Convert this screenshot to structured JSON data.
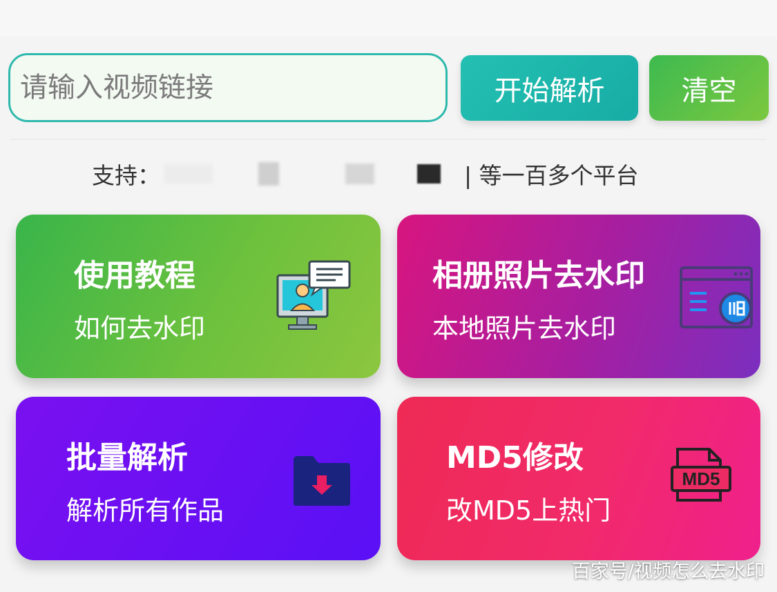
{
  "search": {
    "placeholder": "请输入视频链接",
    "value": ""
  },
  "buttons": {
    "parse_label": "开始解析",
    "clear_label": "清空"
  },
  "support": {
    "prefix": "支持：",
    "suffix": "| 等一百多个平台"
  },
  "cards": [
    {
      "title": "使用教程",
      "subtitle": "如何去水印",
      "icon": "monitor-chat-icon"
    },
    {
      "title": "相册照片去水印",
      "subtitle": "本地照片去水印",
      "icon": "window-app-icon"
    },
    {
      "title": "批量解析",
      "subtitle": "解析所有作品",
      "icon": "folder-download-icon"
    },
    {
      "title": "MD5修改",
      "subtitle": "改MD5上热门",
      "icon": "md5-file-icon",
      "icon_text": "MD5"
    }
  ],
  "watermark": "百家号/视频怎么去水印",
  "colors": {
    "accent_teal": "#1fb5a9",
    "accent_green": "#5fbf45",
    "card_green": "#6cc13d",
    "card_magenta": "#a61fa1",
    "card_purple": "#6a10f2",
    "card_pink": "#f02a6a"
  }
}
